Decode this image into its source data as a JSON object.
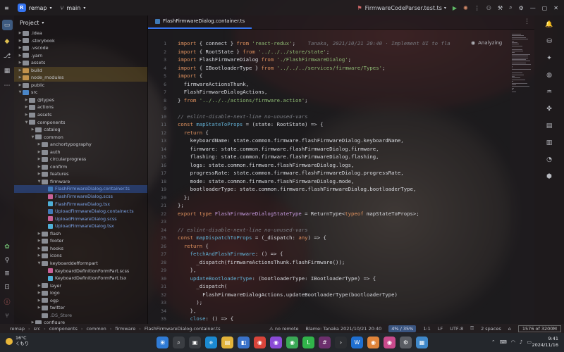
{
  "titlebar": {
    "project_badge": "R",
    "project_name": "remap",
    "branch": "main",
    "run_config": "FirmwareCodeParser.test.ts",
    "icons": [
      "hamburger-icon",
      "branch-icon",
      "run-icon",
      "debug-icon",
      "more-icon",
      "hammer-icon",
      "search-icon",
      "gear-icon",
      "minimize-icon",
      "maximize-icon",
      "close-icon"
    ]
  },
  "project_panel": {
    "title": "Project",
    "tree": [
      {
        "label": ".idea",
        "depth": 1,
        "kind": "folder",
        "collapsed": true
      },
      {
        "label": ".storybook",
        "depth": 1,
        "kind": "folder",
        "collapsed": true
      },
      {
        "label": ".vscode",
        "depth": 1,
        "kind": "folder",
        "collapsed": true
      },
      {
        "label": ".yarn",
        "depth": 1,
        "kind": "folder",
        "collapsed": true
      },
      {
        "label": "assets",
        "depth": 1,
        "kind": "folder",
        "collapsed": true
      },
      {
        "label": "build",
        "depth": 1,
        "kind": "exc",
        "collapsed": true,
        "style": "hl"
      },
      {
        "label": "node_modules",
        "depth": 1,
        "kind": "exc",
        "collapsed": true,
        "style": "hl"
      },
      {
        "label": "public",
        "depth": 1,
        "kind": "folder",
        "collapsed": true
      },
      {
        "label": "src",
        "depth": 1,
        "kind": "folder",
        "collapsed": false
      },
      {
        "label": "@types",
        "depth": 2,
        "kind": "folder",
        "collapsed": true
      },
      {
        "label": "actions",
        "depth": 2,
        "kind": "folder",
        "collapsed": true
      },
      {
        "label": "assets",
        "depth": 2,
        "kind": "folder",
        "collapsed": true
      },
      {
        "label": "components",
        "depth": 2,
        "kind": "folder",
        "collapsed": false
      },
      {
        "label": "catalog",
        "depth": 3,
        "kind": "folder",
        "collapsed": true
      },
      {
        "label": "common",
        "depth": 3,
        "kind": "folder",
        "collapsed": false
      },
      {
        "label": "anchortypography",
        "depth": 4,
        "kind": "folder",
        "collapsed": true
      },
      {
        "label": "auth",
        "depth": 4,
        "kind": "folder",
        "collapsed": true
      },
      {
        "label": "circularprogress",
        "depth": 4,
        "kind": "folder",
        "collapsed": true
      },
      {
        "label": "confirm",
        "depth": 4,
        "kind": "folder",
        "collapsed": true
      },
      {
        "label": "features",
        "depth": 4,
        "kind": "folder",
        "collapsed": true
      },
      {
        "label": "firmware",
        "depth": 4,
        "kind": "folder",
        "collapsed": false
      },
      {
        "label": "FlashFirmwareDialog.container.ts",
        "depth": 5,
        "kind": "ts",
        "style": "sel",
        "color": "blue"
      },
      {
        "label": "FlashFirmwareDialog.scss",
        "depth": 5,
        "kind": "scss",
        "color": "blue"
      },
      {
        "label": "FlashFirmwareDialog.tsx",
        "depth": 5,
        "kind": "tsx",
        "color": "blue"
      },
      {
        "label": "UploadFirmwareDialog.container.ts",
        "depth": 5,
        "kind": "ts",
        "color": "blue"
      },
      {
        "label": "UploadFirmwareDialog.scss",
        "depth": 5,
        "kind": "scss",
        "color": "blue"
      },
      {
        "label": "UploadFirmwareDialog.tsx",
        "depth": 5,
        "kind": "tsx",
        "color": "blue"
      },
      {
        "label": "flash",
        "depth": 4,
        "kind": "folder",
        "collapsed": true
      },
      {
        "label": "footer",
        "depth": 4,
        "kind": "folder",
        "collapsed": true
      },
      {
        "label": "hooks",
        "depth": 4,
        "kind": "folder",
        "collapsed": true
      },
      {
        "label": "icons",
        "depth": 4,
        "kind": "folder",
        "collapsed": true
      },
      {
        "label": "keyboarddefformpart",
        "depth": 4,
        "kind": "folder",
        "collapsed": false
      },
      {
        "label": "KeyboardDefinitionFormPart.scss",
        "depth": 5,
        "kind": "scss"
      },
      {
        "label": "KeyboardDefinitionFormPart.tsx",
        "depth": 5,
        "kind": "tsx"
      },
      {
        "label": "layer",
        "depth": 4,
        "kind": "folder",
        "collapsed": true
      },
      {
        "label": "logo",
        "depth": 4,
        "kind": "folder",
        "collapsed": true
      },
      {
        "label": "ogp",
        "depth": 4,
        "kind": "folder",
        "collapsed": true
      },
      {
        "label": "twitter",
        "depth": 4,
        "kind": "folder",
        "collapsed": true
      },
      {
        "label": ".DS_Store",
        "depth": 4,
        "kind": "file",
        "color": "gray"
      },
      {
        "label": "configure",
        "depth": 3,
        "kind": "folder",
        "collapsed": true
      }
    ]
  },
  "editor": {
    "tab_label": "FlashFirmwareDialog.container.ts",
    "analyzing": "Analyzing",
    "blame_inline": "Tanaka, 2021/10/21 20:40 · Implement UI to fla",
    "lines": [
      [
        [
          "k",
          "import "
        ],
        [
          "p",
          "{ connect } "
        ],
        [
          "k",
          "from "
        ],
        [
          "s",
          "'react-redux'"
        ],
        [
          "p",
          ";"
        ]
      ],
      [
        [
          "k",
          "import "
        ],
        [
          "p",
          "{ RootState } "
        ],
        [
          "k",
          "from "
        ],
        [
          "s",
          "'../../../store/state'"
        ],
        [
          "p",
          ";"
        ]
      ],
      [
        [
          "k",
          "import "
        ],
        [
          "p",
          "FlashFirmwareDialog "
        ],
        [
          "k",
          "from "
        ],
        [
          "s",
          "'./FlashFirmwareDialog'"
        ],
        [
          "p",
          ";"
        ]
      ],
      [
        [
          "k",
          "import "
        ],
        [
          "p",
          "{ IBootloaderType } "
        ],
        [
          "k",
          "from "
        ],
        [
          "s",
          "'../../../services/firmware/Types'"
        ],
        [
          "p",
          ";"
        ]
      ],
      [
        [
          "k",
          "import "
        ],
        [
          "p",
          "{"
        ]
      ],
      [
        [
          "p",
          "  firmwareActionsThunk,"
        ]
      ],
      [
        [
          "p",
          "  FlashFirmwareDialogActions,"
        ]
      ],
      [
        [
          "p",
          "} "
        ],
        [
          "k",
          "from "
        ],
        [
          "s",
          "'../../../actions/firmware.action'"
        ],
        [
          "p",
          ";"
        ]
      ],
      [],
      [
        [
          "c",
          "// eslint-disable-next-line no-unused-vars"
        ]
      ],
      [
        [
          "k",
          "const "
        ],
        [
          "f",
          "mapStateToProps"
        ],
        [
          "p",
          " = (state: RootState) => {"
        ]
      ],
      [
        [
          "k",
          "  return "
        ],
        [
          "p",
          "{"
        ]
      ],
      [
        [
          "p",
          "    keyboardName: state.common.firmware.flashFirmwareDialog.keyboardName,"
        ]
      ],
      [
        [
          "p",
          "    firmware: state.common.firmware.flashFirmwareDialog.firmware,"
        ]
      ],
      [
        [
          "p",
          "    flashing: state.common.firmware.flashFirmwareDialog.flashing,"
        ]
      ],
      [
        [
          "p",
          "    logs: state.common.firmware.flashFirmwareDialog.logs,"
        ]
      ],
      [
        [
          "p",
          "    progressRate: state.common.firmware.flashFirmwareDialog.progressRate,"
        ]
      ],
      [
        [
          "p",
          "    mode: state.common.firmware.flashFirmwareDialog.mode,"
        ]
      ],
      [
        [
          "p",
          "    bootloaderType: state.common.firmware.flashFirmwareDialog.bootloaderType,"
        ]
      ],
      [
        [
          "p",
          "  };"
        ]
      ],
      [
        [
          "p",
          "};"
        ]
      ],
      [
        [
          "k",
          "export type "
        ],
        [
          "t",
          "FlashFirmwareDialogStateType"
        ],
        [
          "p",
          " = ReturnType<"
        ],
        [
          "k",
          "typeof "
        ],
        [
          "p",
          "mapStateToProps>;"
        ]
      ],
      [],
      [
        [
          "c",
          "// eslint-disable-next-line no-unused-vars"
        ]
      ],
      [
        [
          "k",
          "const "
        ],
        [
          "f",
          "mapDispatchToProps"
        ],
        [
          "p",
          " = (_dispatch: "
        ],
        [
          "k",
          "any"
        ],
        [
          "p",
          ") => {"
        ]
      ],
      [
        [
          "k",
          "  return "
        ],
        [
          "p",
          "{"
        ]
      ],
      [
        [
          "f",
          "    fetchAndFlashFirmware"
        ],
        [
          "p",
          ": () => {"
        ]
      ],
      [
        [
          "p",
          "      _dispatch(firmwareActionsThunk.flashFirmware());"
        ]
      ],
      [
        [
          "p",
          "    },"
        ]
      ],
      [
        [
          "f",
          "    updateBootloaderType"
        ],
        [
          "p",
          ": (bootloaderType: IBootloaderType) => {"
        ]
      ],
      [
        [
          "p",
          "      _dispatch("
        ]
      ],
      [
        [
          "p",
          "        FlashFirmwareDialogActions.updateBootloaderType(bootloaderType)"
        ]
      ],
      [
        [
          "p",
          "      );"
        ]
      ],
      [
        [
          "p",
          "    },"
        ]
      ],
      [
        [
          "f",
          "    close"
        ],
        [
          "p",
          ": () => {"
        ]
      ]
    ]
  },
  "statusbar": {
    "breadcrumbs": [
      "remap",
      "src",
      "components",
      "common",
      "firmware",
      "FlashFirmwareDialog.container.ts"
    ],
    "remote": "no remote",
    "blame": "Blame: Tanaka 2021/10/21 20:40",
    "progress": "4% / 35%",
    "position": "1:1",
    "line_sep": "LF",
    "encoding": "UTF-8",
    "indent": "2 spaces",
    "memory": "1576 of 3200M"
  },
  "taskbar": {
    "temp": "16°C",
    "weather": "くもり",
    "time": "9:41",
    "date": "2024/11/16",
    "apps": [
      {
        "name": "windows-start-icon",
        "color": "#2f7bd6",
        "glyph": "⊞"
      },
      {
        "name": "search-icon",
        "color": "#3a3d42",
        "glyph": "⌕"
      },
      {
        "name": "task-view-icon",
        "color": "#3a3d42",
        "glyph": "▣"
      },
      {
        "name": "edge-icon",
        "color": "#1b8ad1",
        "glyph": "e"
      },
      {
        "name": "file-explorer-icon",
        "color": "#e2b33a",
        "glyph": "▤"
      },
      {
        "name": "store-icon",
        "color": "#3a72c9",
        "glyph": "◧"
      },
      {
        "name": "chrome-icon",
        "color": "#d9443a",
        "glyph": "◉"
      },
      {
        "name": "chrome-profile-icon",
        "color": "#8a4ad6",
        "glyph": "◉"
      },
      {
        "name": "chrome-alt-icon",
        "color": "#3aa856",
        "glyph": "◉"
      },
      {
        "name": "line-icon",
        "color": "#31b34a",
        "glyph": "L"
      },
      {
        "name": "slack-icon",
        "color": "#6c2f6d",
        "glyph": "#"
      },
      {
        "name": "terminal-icon",
        "color": "#2b2d31",
        "glyph": "›"
      },
      {
        "name": "webstorm-icon",
        "color": "#1f6fd1",
        "glyph": "W"
      },
      {
        "name": "chrome-dev-icon",
        "color": "#e0843a",
        "glyph": "◉"
      },
      {
        "name": "chrome-canary-icon",
        "color": "#c94a8c",
        "glyph": "◉"
      },
      {
        "name": "settings-icon",
        "color": "#5a5d63",
        "glyph": "⚙"
      },
      {
        "name": "photos-icon",
        "color": "#3f88c9",
        "glyph": "▦"
      }
    ]
  }
}
